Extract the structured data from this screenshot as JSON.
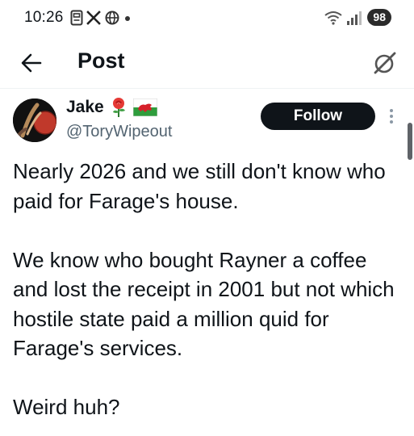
{
  "status_bar": {
    "time": "10:26",
    "battery": "98",
    "icons": [
      "notification-app-icon",
      "x-app-icon",
      "app-icon",
      "dot-icon",
      "wifi-icon",
      "signal-icon"
    ]
  },
  "header": {
    "back_icon": "arrow-left-icon",
    "title": "Post",
    "grok_icon": "grok-icon"
  },
  "author": {
    "display_name": "Jake",
    "handle": "@ToryWipeout",
    "badges": [
      "rose-emoji",
      "wales-flag-emoji"
    ]
  },
  "follow_button": {
    "label": "Follow"
  },
  "post": {
    "text": "Nearly 2026 and we still don't know who paid for Farage's house.\n\nWe know who bought Rayner a coffee and lost the receipt in 2001 but not which hostile state paid a million quid for Farage's services.\n\nWeird huh?"
  },
  "colors": {
    "text": "#0f1419",
    "secondary": "#536471",
    "follow_bg": "#0f1419",
    "follow_text": "#ffffff"
  }
}
